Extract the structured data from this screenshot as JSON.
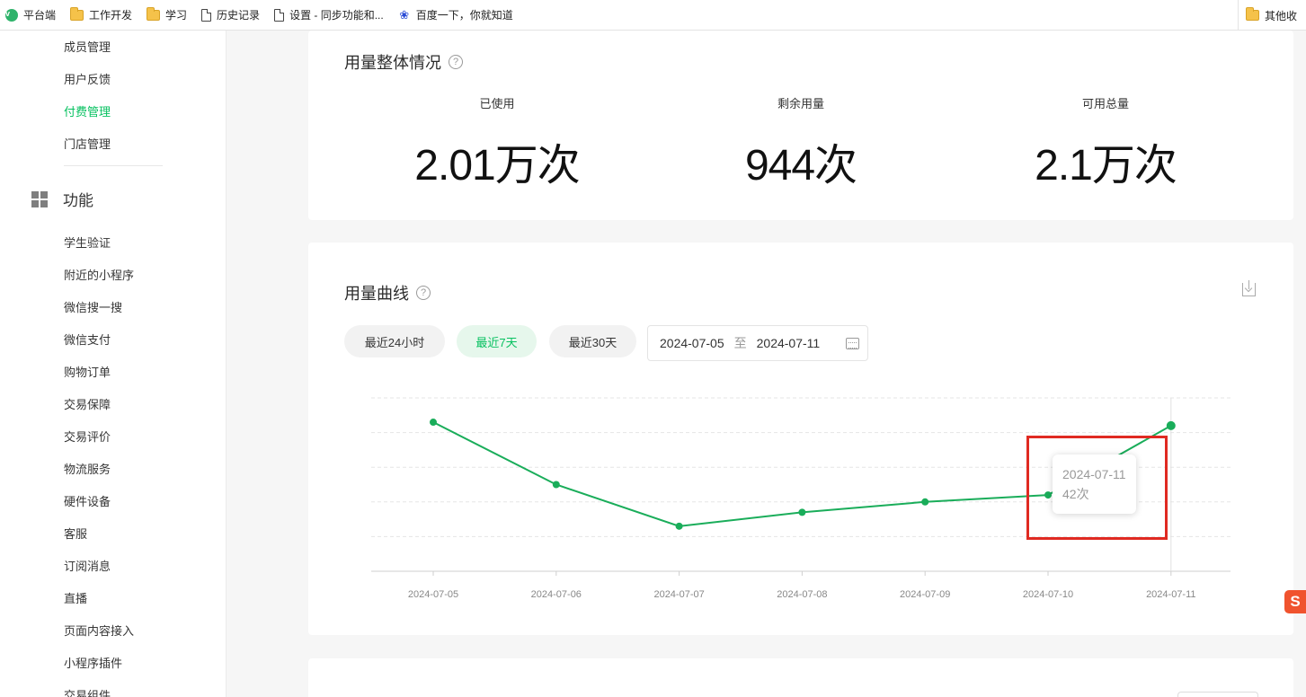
{
  "bookmarks": {
    "items": [
      {
        "label": "平台端",
        "icon": "v-logo-icon"
      },
      {
        "label": "工作开发",
        "icon": "folder-icon"
      },
      {
        "label": "学习",
        "icon": "folder-icon"
      },
      {
        "label": "历史记录",
        "icon": "page-icon"
      },
      {
        "label": "设置 - 同步功能和...",
        "icon": "page-icon"
      },
      {
        "label": "百度一下，你就知道",
        "icon": "baidu-icon"
      }
    ],
    "other": "其他收"
  },
  "sidebar": {
    "items_top": [
      "成员管理",
      "用户反馈",
      "付费管理",
      "门店管理"
    ],
    "active": "付费管理",
    "section_title": "功能",
    "items_func": [
      "学生验证",
      "附近的小程序",
      "微信搜一搜",
      "微信支付",
      "购物订单",
      "交易保障",
      "交易评价",
      "物流服务",
      "硬件设备",
      "客服",
      "订阅消息",
      "直播",
      "页面内容接入",
      "小程序插件",
      "交易组件"
    ]
  },
  "overview": {
    "title": "用量整体情况",
    "help": "?",
    "stats": [
      {
        "label": "已使用",
        "value": "2.01万次"
      },
      {
        "label": "剩余用量",
        "value": "944次"
      },
      {
        "label": "可用总量",
        "value": "2.1万次"
      }
    ]
  },
  "curve": {
    "title": "用量曲线",
    "help": "?",
    "ranges": [
      "最近24小时",
      "最近7天",
      "最近30天"
    ],
    "active_range": "最近7天",
    "date_from": "2024-07-05",
    "date_sep": "至",
    "date_to": "2024-07-11",
    "tooltip": {
      "date": "2024-07-11",
      "value": "42次"
    }
  },
  "chart_data": {
    "type": "line",
    "x": [
      "2024-07-05",
      "2024-07-06",
      "2024-07-07",
      "2024-07-08",
      "2024-07-09",
      "2024-07-10",
      "2024-07-11"
    ],
    "series": [
      {
        "values": [
          43,
          25,
          13,
          17,
          20,
          22,
          42
        ]
      }
    ],
    "ylim": [
      0,
      50
    ],
    "grid": true,
    "line_color": "#1aad5a",
    "highlight_color": "#e02a22"
  }
}
